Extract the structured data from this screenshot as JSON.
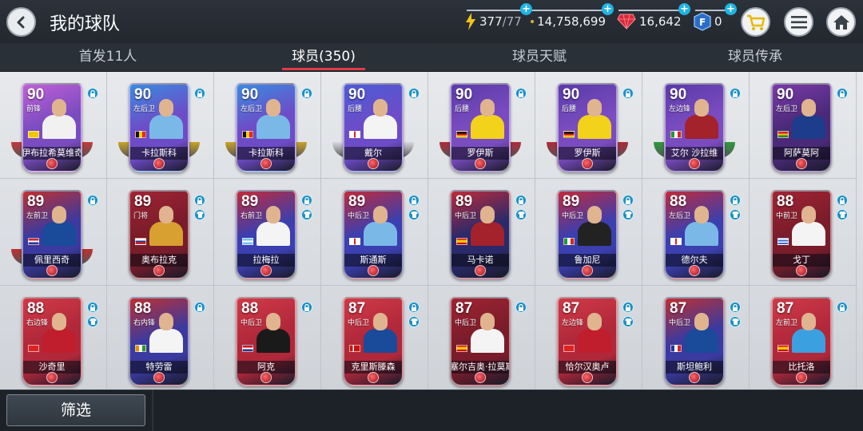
{
  "header": {
    "title": "我的球队",
    "energy": {
      "current": "377",
      "max": "/77"
    },
    "coins": "14,758,699",
    "gems": "16,642",
    "fifa_points": "0"
  },
  "tabs": [
    {
      "label": "首发11人",
      "active": false
    },
    {
      "label": "球员(350)",
      "active": true
    },
    {
      "label": "球员天赋",
      "active": false
    },
    {
      "label": "球员传承",
      "active": false
    }
  ],
  "players": [
    {
      "rating": "90",
      "pos": "前锋",
      "name": "伊布拉希莫维奇",
      "card": "#7a4cc0",
      "accent": "#c05fd6",
      "ribbon": "#c23a3a",
      "kit": "#f1f1f1",
      "flag": "se"
    },
    {
      "rating": "90",
      "pos": "左后卫",
      "name": "卡拉斯科",
      "card": "#6e4cc8",
      "accent": "#3a8be0",
      "ribbon": "#c9a227",
      "kit": "#7ab8e8",
      "flag": "be"
    },
    {
      "rating": "90",
      "pos": "左后卫",
      "name": "卡拉斯科",
      "card": "#6e4cc8",
      "accent": "#3a8be0",
      "ribbon": "#c9a227",
      "kit": "#7ab8e8",
      "flag": "be"
    },
    {
      "rating": "90",
      "pos": "后腰",
      "name": "戴尔",
      "card": "#6e4cc8",
      "accent": "#4a5cd6",
      "ribbon": "#d8d8e0",
      "kit": "#f4f4f4",
      "flag": "en"
    },
    {
      "rating": "90",
      "pos": "后腰",
      "name": "罗伊斯",
      "card": "#7a4cc0",
      "accent": "#5a3aa8",
      "ribbon": "#b02a3a",
      "kit": "#f2d21a",
      "flag": "de"
    },
    {
      "rating": "90",
      "pos": "后腰",
      "name": "罗伊斯",
      "card": "#7a4cc0",
      "accent": "#5a3aa8",
      "ribbon": "#b02a3a",
      "kit": "#f2d21a",
      "flag": "de"
    },
    {
      "rating": "90",
      "pos": "左边锋",
      "name": "艾尔 沙拉维",
      "card": "#7a4cc0",
      "accent": "#5a3aa8",
      "ribbon": "#2c9a3c",
      "kit": "#a3222c",
      "flag": "it"
    },
    {
      "rating": "90",
      "pos": "左后卫",
      "name": "阿萨莫阿",
      "card": "#4a2a78",
      "accent": "#7a3aa8",
      "ribbon": "",
      "kit": "#1d3c8c",
      "flag": "gh"
    },
    {
      "rating": "89",
      "pos": "左前卫",
      "name": "佩里西奇",
      "card": "#3a3aa0",
      "accent": "#c03030",
      "ribbon": "#c03030",
      "kit": "#1a4a9a",
      "flag": "hr"
    },
    {
      "rating": "89",
      "pos": "门将",
      "name": "奥布拉克",
      "card": "#7a1c2a",
      "accent": "#a02434",
      "ribbon": "",
      "kit": "#d8a030",
      "flag": "si"
    },
    {
      "rating": "89",
      "pos": "右前卫",
      "name": "拉梅拉",
      "card": "#3b3fb0",
      "accent": "#c02a3a",
      "ribbon": "",
      "kit": "#f4f4f4",
      "flag": "ar"
    },
    {
      "rating": "89",
      "pos": "中后卫",
      "name": "斯通斯",
      "card": "#3b3fb0",
      "accent": "#c02a3a",
      "ribbon": "",
      "kit": "#7ab8e8",
      "flag": "en"
    },
    {
      "rating": "89",
      "pos": "中后卫",
      "name": "马卡诺",
      "card": "#2a2a6a",
      "accent": "#c02a3a",
      "ribbon": "",
      "kit": "#a3222c",
      "flag": "es"
    },
    {
      "rating": "89",
      "pos": "中后卫",
      "name": "鲁加尼",
      "card": "#3b3fb0",
      "accent": "#c02a3a",
      "ribbon": "",
      "kit": "#222222",
      "flag": "it"
    },
    {
      "rating": "88",
      "pos": "左后卫",
      "name": "德尔夫",
      "card": "#3b3fb0",
      "accent": "#c02a3a",
      "ribbon": "",
      "kit": "#7ab8e8",
      "flag": "en"
    },
    {
      "rating": "88",
      "pos": "中前卫",
      "name": "戈丁",
      "card": "#7a1c2a",
      "accent": "#a02434",
      "ribbon": "",
      "kit": "#f4f4f4",
      "flag": "uy"
    },
    {
      "rating": "88",
      "pos": "右边锋",
      "name": "沙奇里",
      "card": "#b0283a",
      "accent": "#d03a48",
      "ribbon": "",
      "kit": "#c01e2c",
      "flag": "ch"
    },
    {
      "rating": "88",
      "pos": "右内锋",
      "name": "特劳雷",
      "card": "#3a3aa0",
      "accent": "#c03030",
      "ribbon": "",
      "kit": "#f4f4f4",
      "flag": "ci"
    },
    {
      "rating": "88",
      "pos": "中后卫",
      "name": "阿克",
      "card": "#b0283a",
      "accent": "#d03a48",
      "ribbon": "",
      "kit": "#1a1a1a",
      "flag": "nl"
    },
    {
      "rating": "87",
      "pos": "中后卫",
      "name": "克里斯滕森",
      "card": "#b0283a",
      "accent": "#d03a48",
      "ribbon": "",
      "kit": "#1a4a9a",
      "flag": "dk"
    },
    {
      "rating": "87",
      "pos": "中后卫",
      "name": "塞尔吉奥·拉莫斯",
      "card": "#7a1c2a",
      "accent": "#a02434",
      "ribbon": "",
      "kit": "#f4f4f4",
      "flag": "es"
    },
    {
      "rating": "87",
      "pos": "左边锋",
      "name": "恰尔汉奥卢",
      "card": "#b0283a",
      "accent": "#d03a48",
      "ribbon": "",
      "kit": "#c01e2c",
      "flag": "tr"
    },
    {
      "rating": "87",
      "pos": "中后卫",
      "name": "斯坦鲍利",
      "card": "#3a3aa0",
      "accent": "#c03030",
      "ribbon": "",
      "kit": "#1a4a9a",
      "flag": "fr"
    },
    {
      "rating": "87",
      "pos": "左前卫",
      "name": "比托洛",
      "card": "#b0283a",
      "accent": "#d03a48",
      "ribbon": "",
      "kit": "#3aa0e0",
      "flag": "es"
    }
  ],
  "bottom": {
    "filter_label": "筛选"
  }
}
